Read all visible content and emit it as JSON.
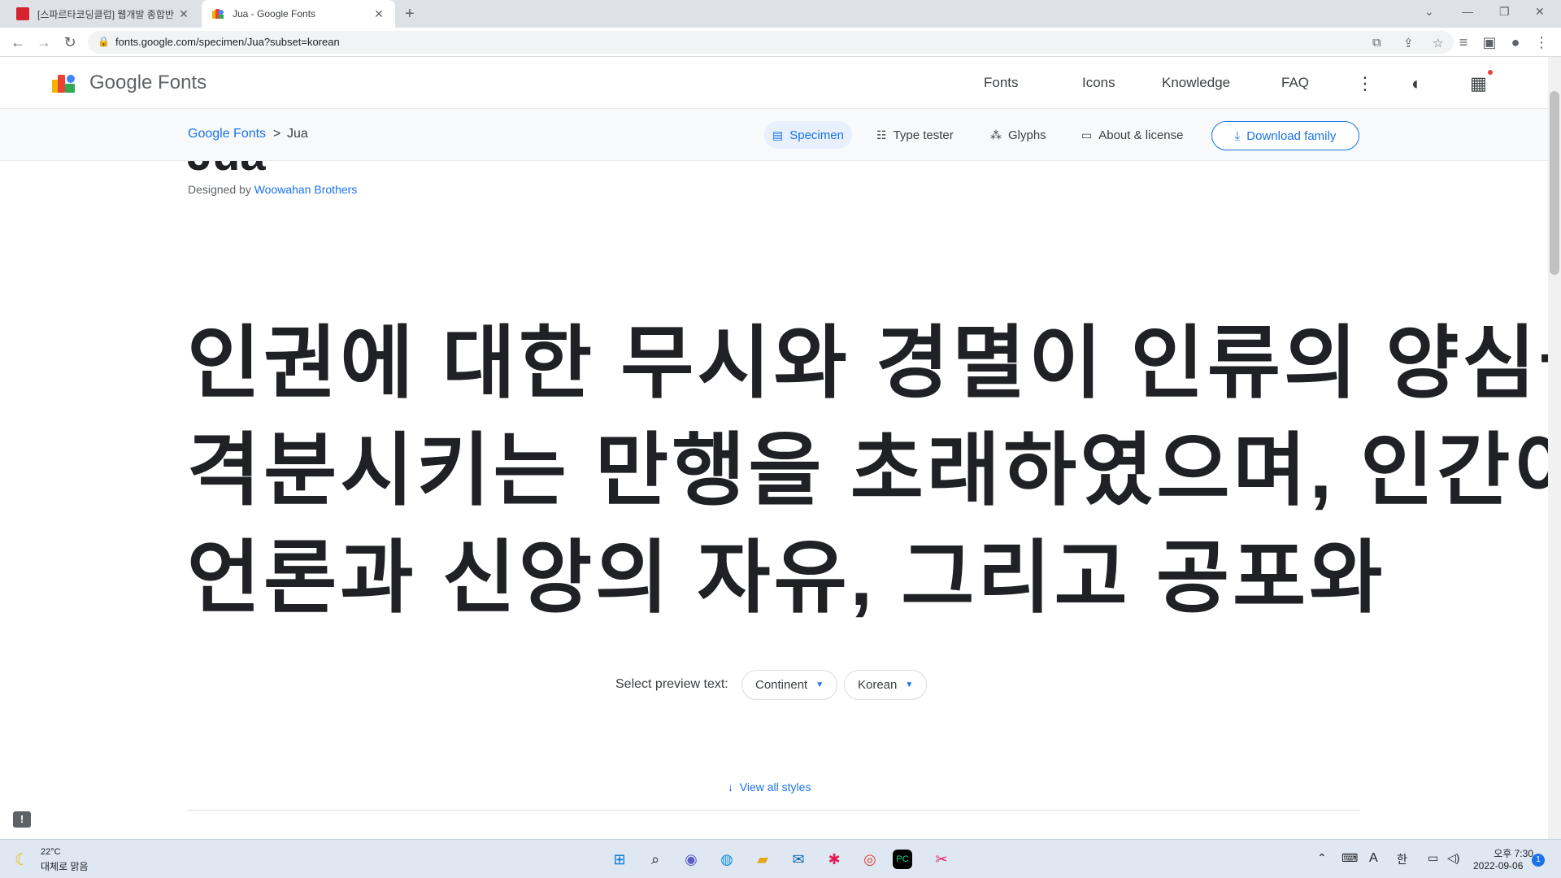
{
  "browser": {
    "tabs": [
      {
        "title": "[스파르타코딩클럽] 웹개발 종합반",
        "active": false
      },
      {
        "title": "Jua - Google Fonts",
        "active": true
      }
    ],
    "url": "fonts.google.com/specimen/Jua?subset=korean"
  },
  "header": {
    "brand": "Google Fonts",
    "nav": [
      "Fonts",
      "Icons",
      "Knowledge",
      "FAQ"
    ]
  },
  "subnav": {
    "breadcrumb_root": "Google Fonts",
    "breadcrumb_sep": ">",
    "breadcrumb_current": "Jua",
    "tabs": [
      "Specimen",
      "Type tester",
      "Glyphs",
      "About & license"
    ],
    "active_tab": "Specimen",
    "download_label": "Download family"
  },
  "font": {
    "name": "Jua",
    "designed_by_prefix": "Designed by",
    "designer": "Woowahan Brothers"
  },
  "preview": {
    "lines": [
      "인권에 대한 무시와 경멸이 인류의 양심을",
      "격분시키는 만행을 초래하였으며, 인간이",
      "언론과 신앙의 자유, 그리고 공포와"
    ]
  },
  "preview_select": {
    "label": "Select preview text:",
    "continent": "Continent",
    "language": "Korean"
  },
  "view_all_styles": "View all styles",
  "taskbar": {
    "temperature": "22°C",
    "weather": "대체로 맑음",
    "ime_mode": "A",
    "ime_lang": "한",
    "time": "오후 7:30",
    "date": "2022-09-06",
    "notification_count": "1"
  },
  "colors": {
    "accent": "#1a73e8",
    "text": "#202124",
    "subbar_bg": "#f8f9fa"
  }
}
